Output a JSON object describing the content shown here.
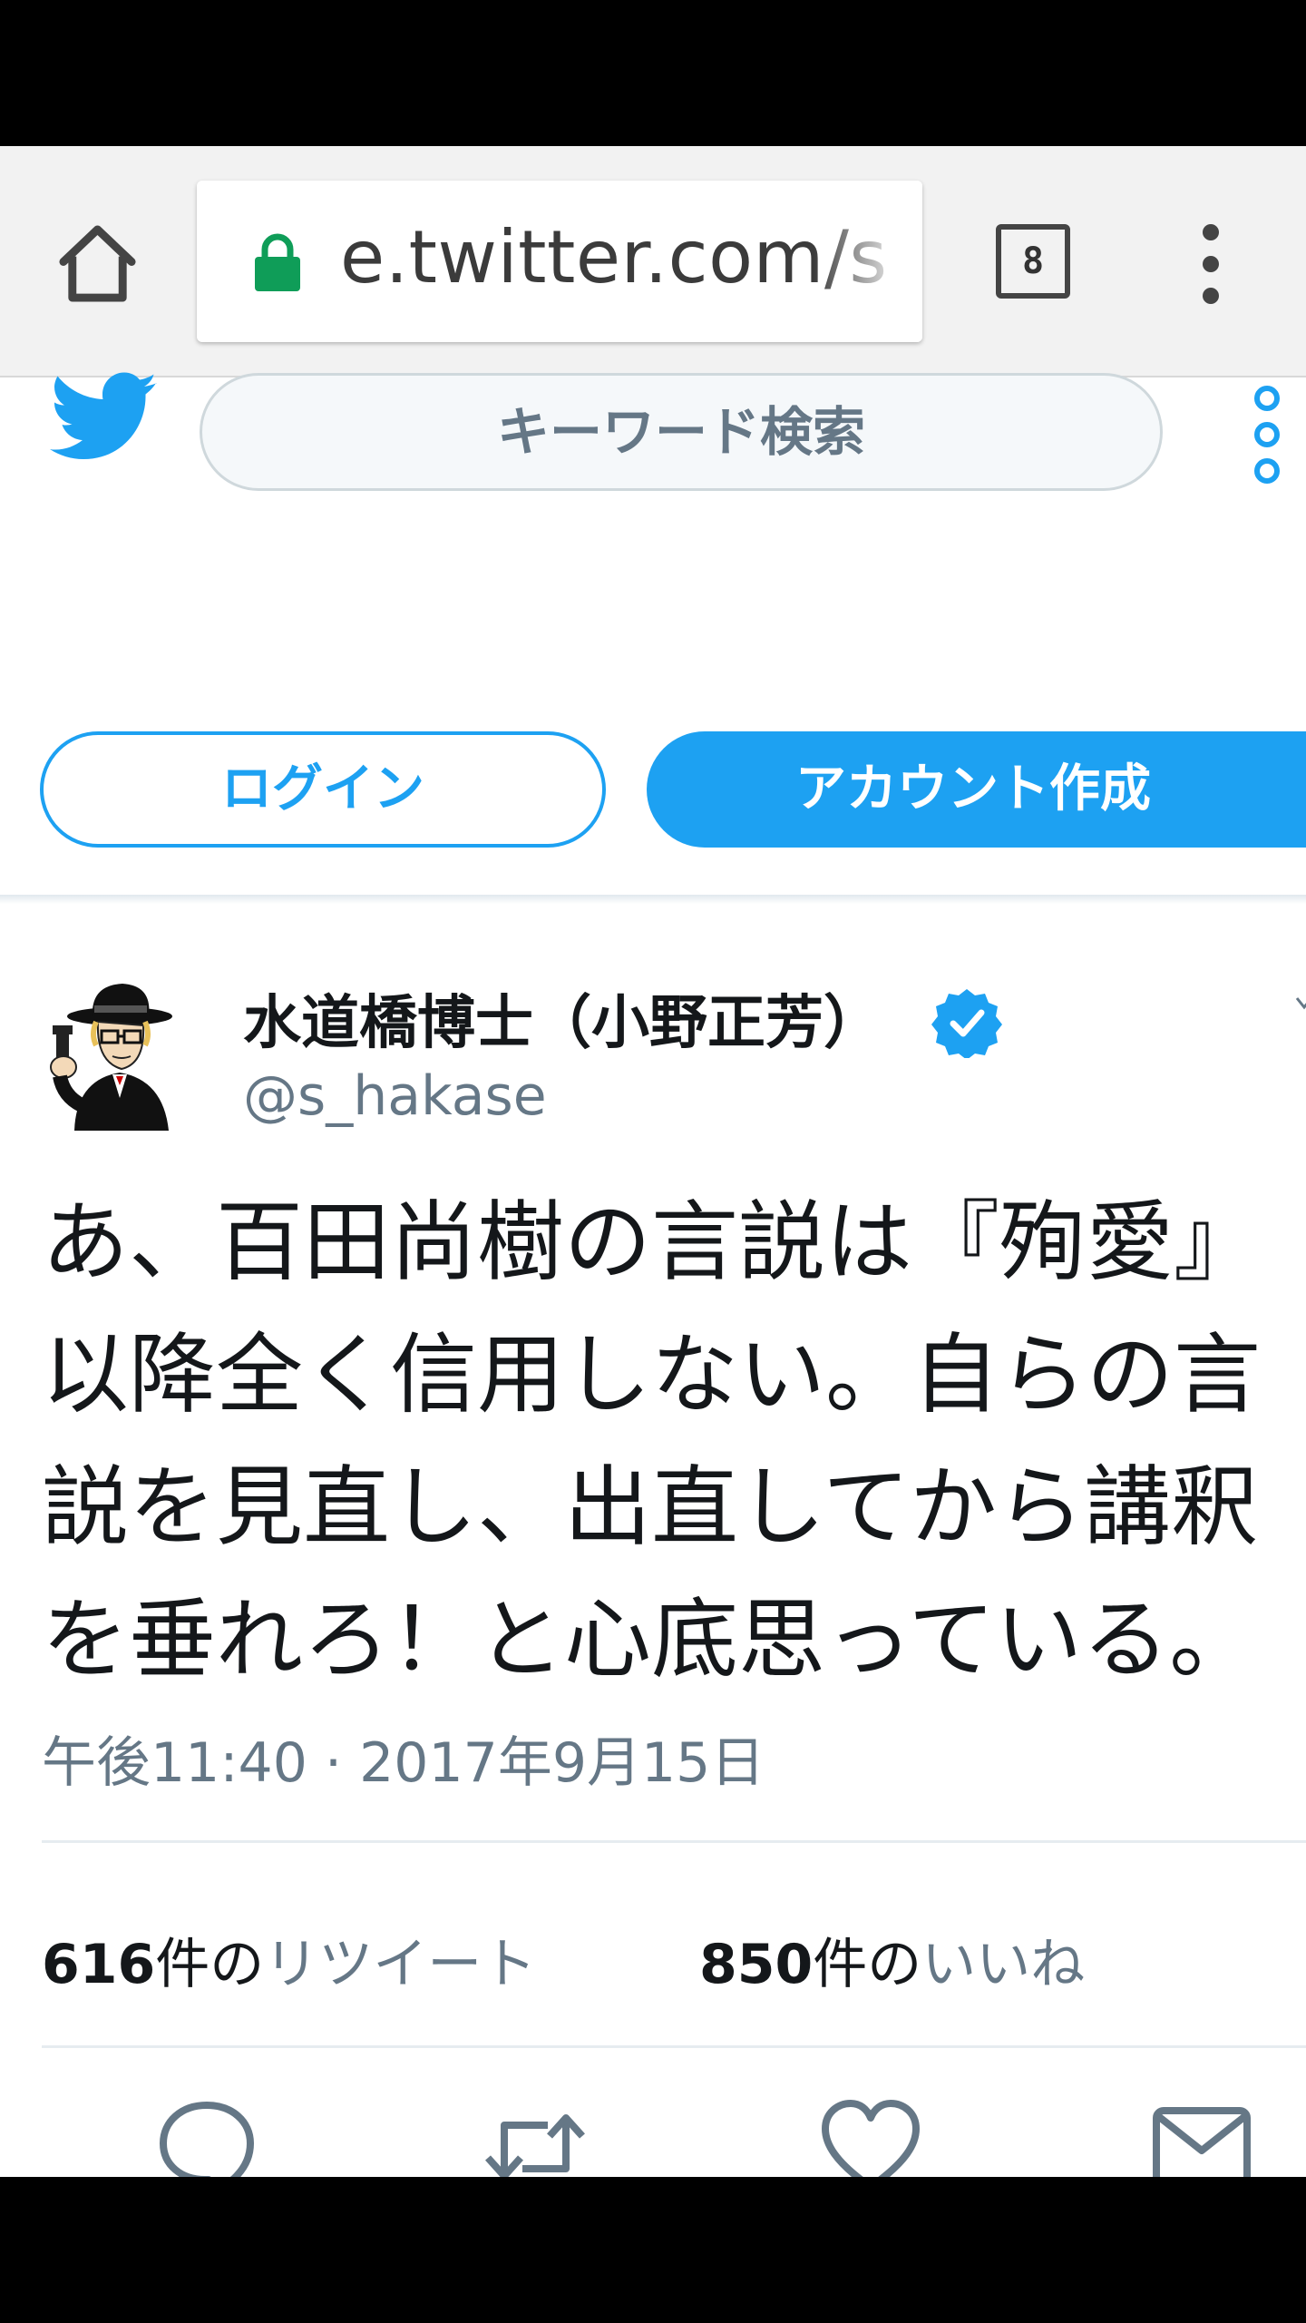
{
  "browser": {
    "url": "e.twitter.com/s",
    "tab_count": "8",
    "icons": {
      "home": "home-icon",
      "lock": "lock-icon",
      "tabs": "tab-switcher-icon",
      "menu": "more-vert-icon"
    },
    "colors": {
      "lock": "#0f9d58"
    }
  },
  "header": {
    "search_placeholder": "キーワード検索",
    "login_label": "ログイン",
    "signup_label": "アカウント作成",
    "colors": {
      "brand": "#1da1f2"
    }
  },
  "tweet": {
    "display_name": "水道橋博士（小野正芳）",
    "handle": "@s_hakase",
    "text_lines": [
      "あ、百田尚樹の言説は『殉愛』",
      "以降全く信用しない。自らの言",
      "説を見直し、出直してから講釈",
      "を垂れろ！と心底思っている。"
    ],
    "timestamp": "午後11:40 · 2017年9月15日",
    "retweets": {
      "count": "616",
      "unit": "件の",
      "label": "リツイート"
    },
    "likes": {
      "count": "850",
      "unit": "件の",
      "label": "いいね"
    },
    "actions": [
      "reply-icon",
      "retweet-icon",
      "like-icon",
      "direct-message-icon"
    ]
  }
}
